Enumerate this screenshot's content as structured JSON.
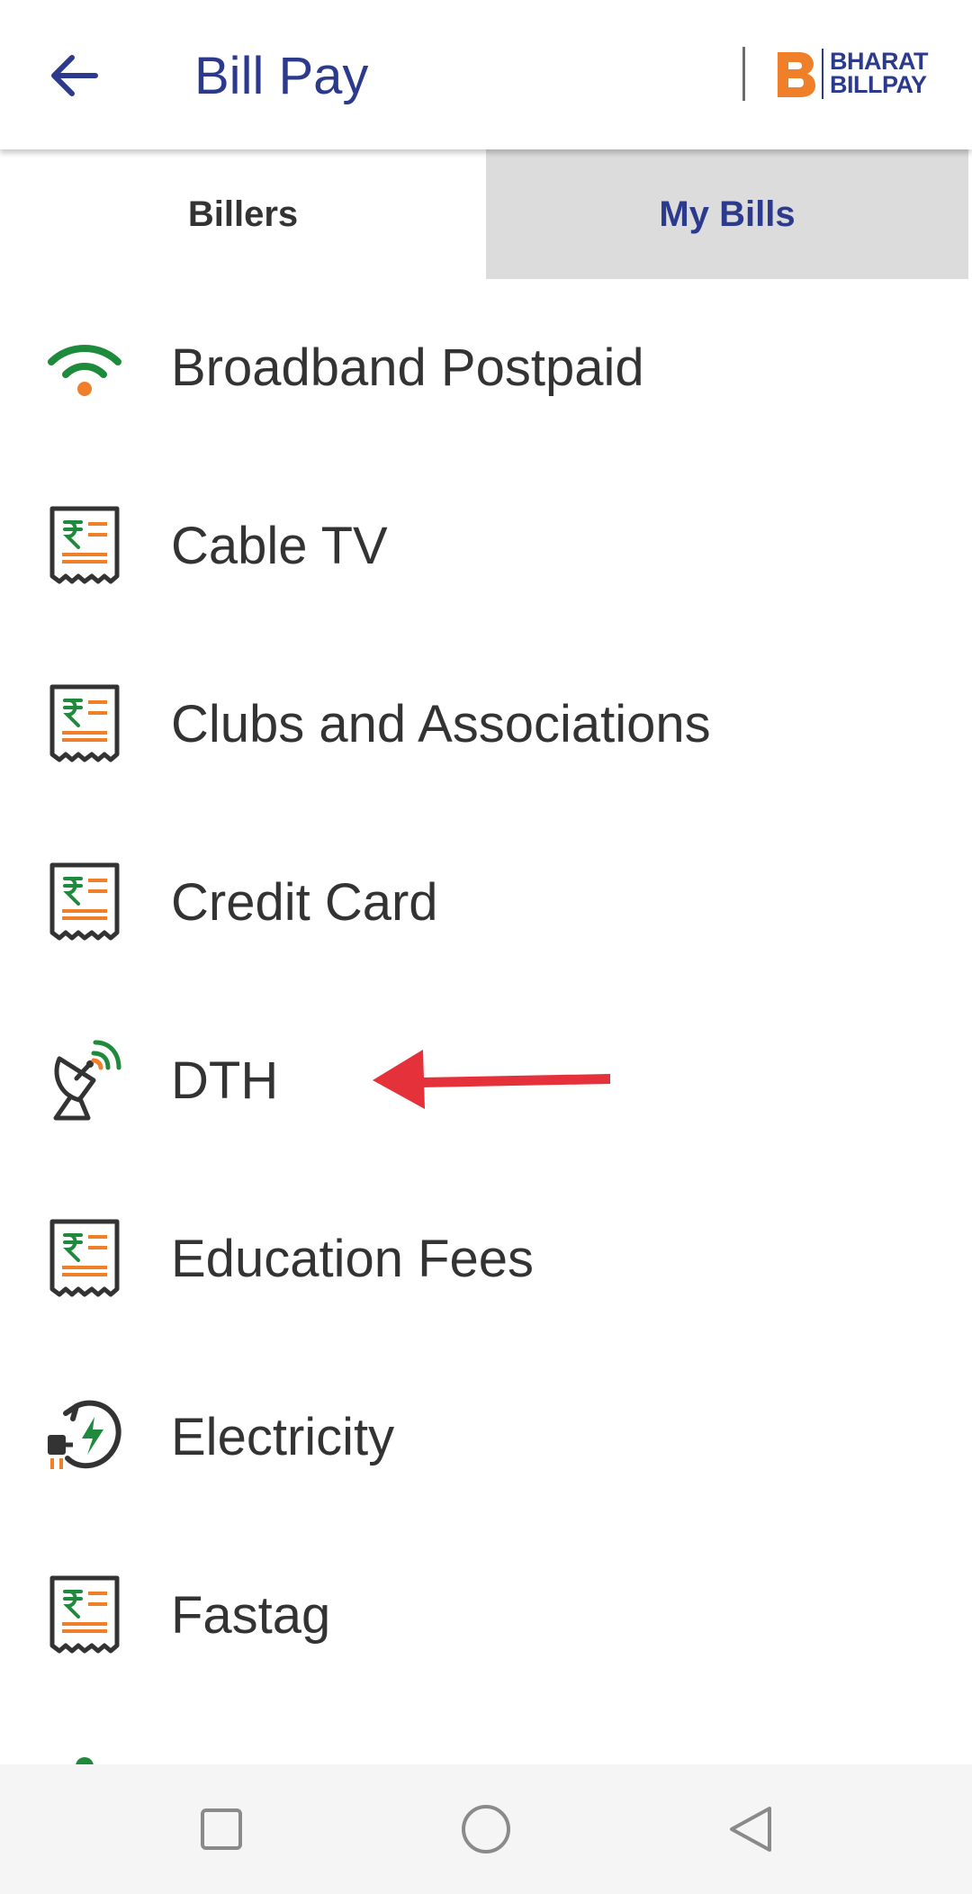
{
  "header": {
    "title": "Bill Pay",
    "back_icon": "arrow-left-icon",
    "logo": {
      "line1": "BHARAT",
      "line2": "BILLPAY"
    }
  },
  "tabs": [
    {
      "label": "Billers",
      "active": true
    },
    {
      "label": "My Bills",
      "active": false
    }
  ],
  "billers": [
    {
      "label": "Broadband Postpaid",
      "icon": "wifi-icon"
    },
    {
      "label": "Cable TV",
      "icon": "rupee-receipt-icon"
    },
    {
      "label": "Clubs and Associations",
      "icon": "rupee-receipt-icon"
    },
    {
      "label": "Credit Card",
      "icon": "rupee-receipt-icon"
    },
    {
      "label": "DTH",
      "icon": "satellite-dish-icon"
    },
    {
      "label": "Education Fees",
      "icon": "rupee-receipt-icon"
    },
    {
      "label": "Electricity",
      "icon": "electricity-plug-icon"
    },
    {
      "label": "Fastag",
      "icon": "rupee-receipt-icon"
    }
  ],
  "colors": {
    "brand_blue": "#2b3a8c",
    "accent_orange": "#f07f2a",
    "green": "#1e8a3c",
    "arrow_red": "#e5313a",
    "tab_inactive_bg": "#dcdcdc",
    "nav_bg": "#f5f5f5"
  },
  "nav_bar": {
    "buttons": [
      "recent-apps-icon",
      "home-icon",
      "back-triangle-icon"
    ]
  }
}
